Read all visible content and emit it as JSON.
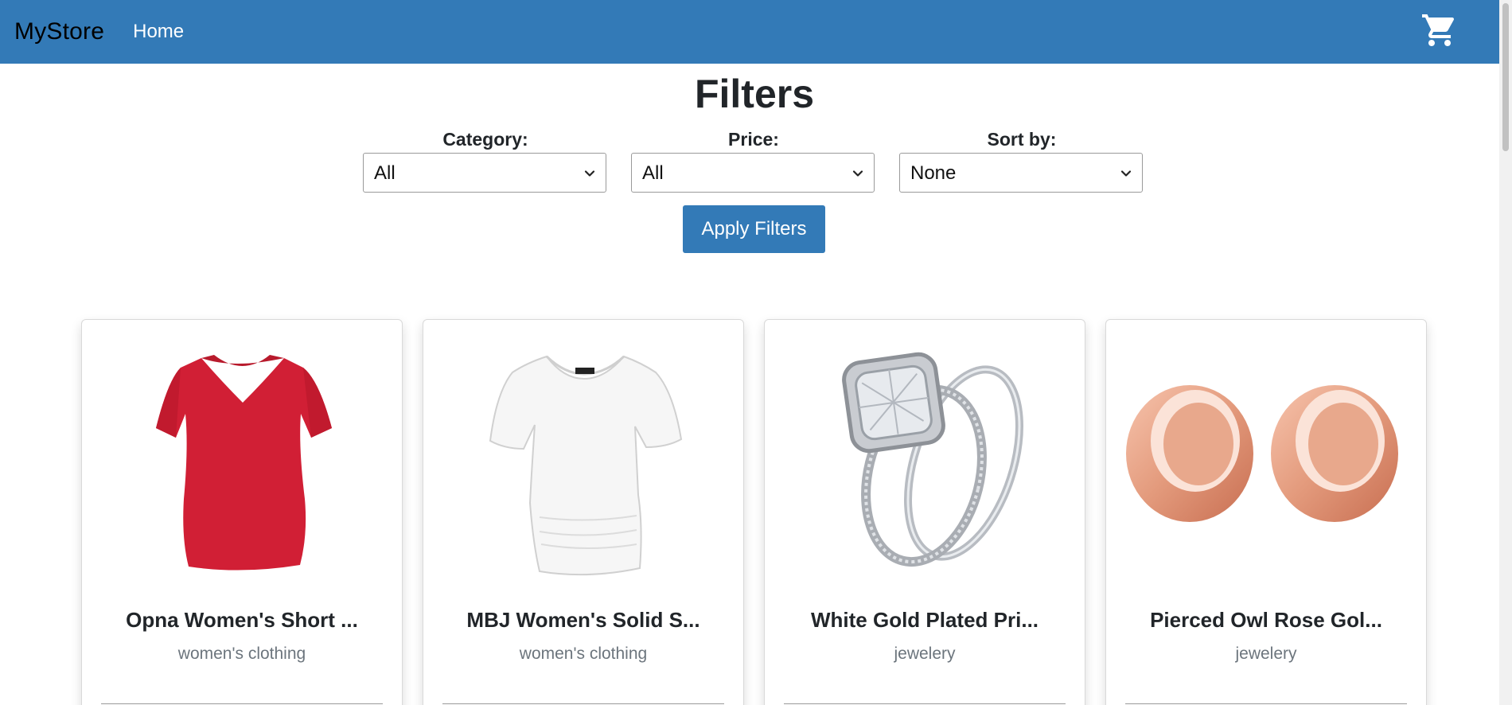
{
  "nav": {
    "brand": "MyStore",
    "home_label": "Home",
    "cart_icon": "cart-icon",
    "bg_color": "#337ab7"
  },
  "filters": {
    "title": "Filters",
    "category": {
      "label": "Category:",
      "value": "All"
    },
    "price": {
      "label": "Price:",
      "value": "All"
    },
    "sort": {
      "label": "Sort by:",
      "value": "None"
    },
    "apply_label": "Apply Filters"
  },
  "products": [
    {
      "title": "Opna Women's Short ...",
      "category": "women's clothing",
      "image_icon": "red-vneck-tshirt-image"
    },
    {
      "title": "MBJ Women's Solid S...",
      "category": "women's clothing",
      "image_icon": "white-tshirt-image"
    },
    {
      "title": "White Gold Plated Pri...",
      "category": "jewelery",
      "image_icon": "diamond-ring-image"
    },
    {
      "title": "Pierced Owl Rose Gol...",
      "category": "jewelery",
      "image_icon": "rose-gold-tunnels-image"
    }
  ]
}
